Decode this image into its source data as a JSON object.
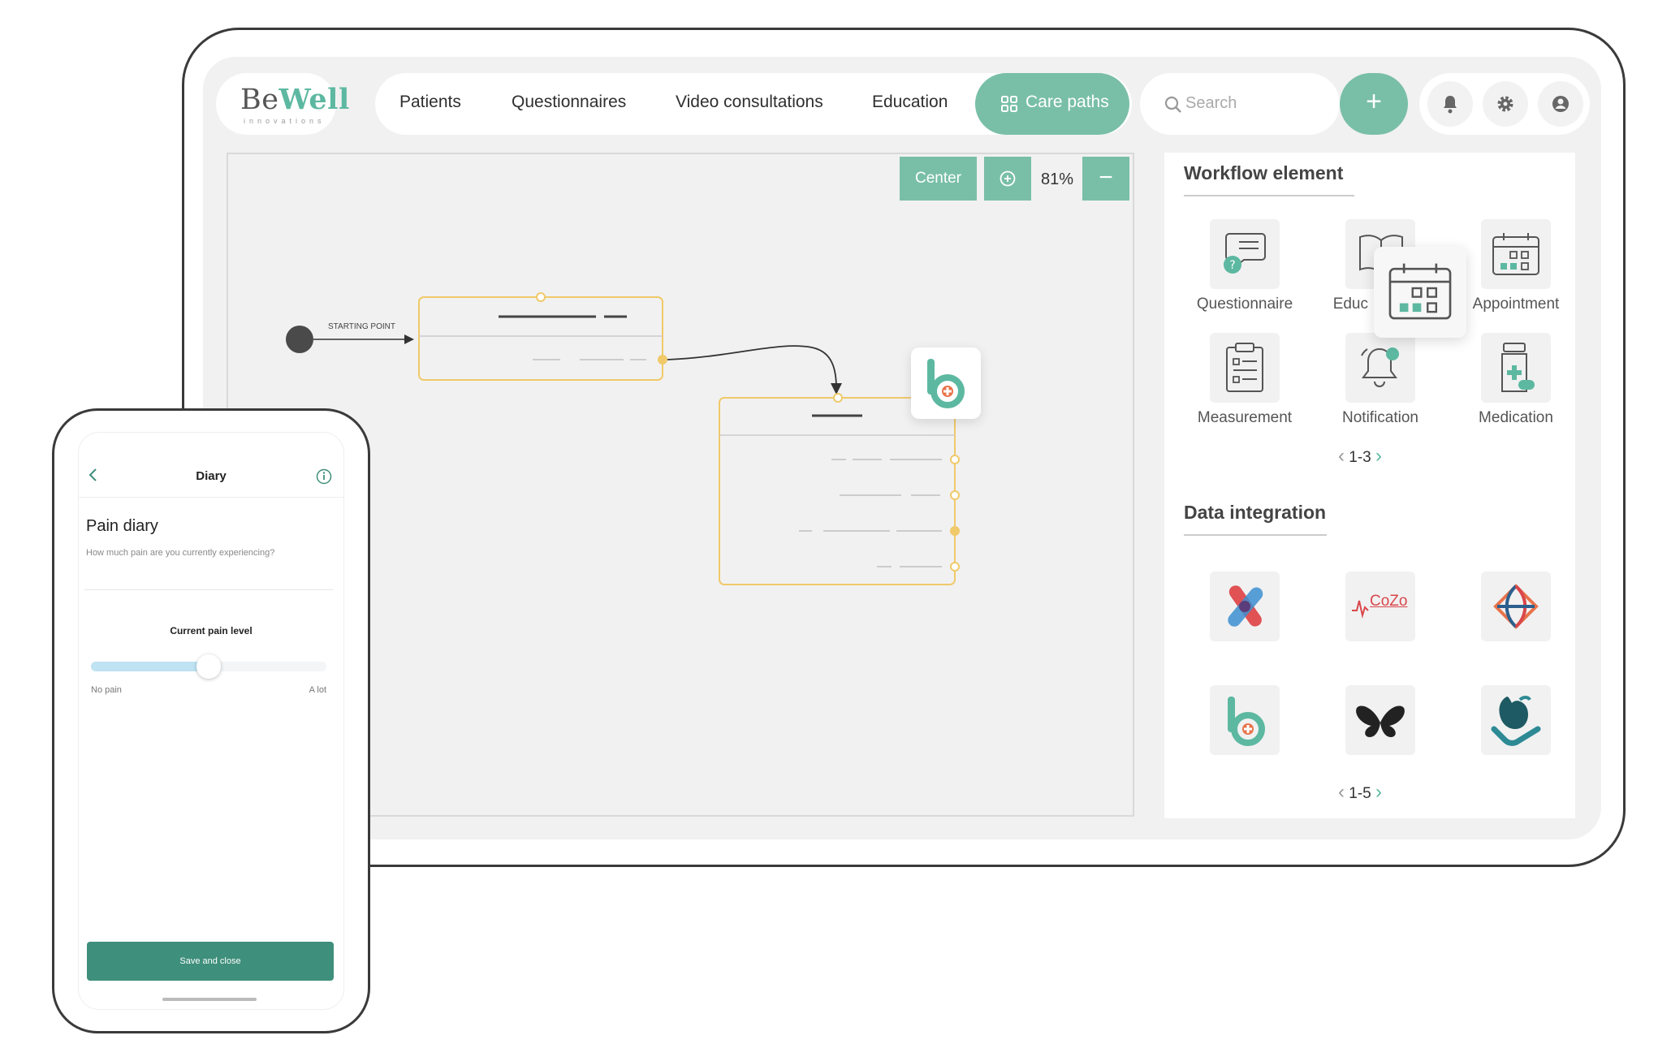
{
  "brand": {
    "name_a": "Be",
    "name_b": "Well",
    "tagline": "innovations"
  },
  "nav": {
    "items": [
      "Patients",
      "Questionnaires",
      "Video consultations",
      "Education"
    ],
    "active": "Care paths",
    "search_placeholder": "Search"
  },
  "canvas": {
    "center_label": "Center",
    "zoom": "81%",
    "start_label": "STARTING POINT"
  },
  "panel": {
    "workflow_title": "Workflow element",
    "workflow_items": [
      "Questionnaire",
      "Education",
      "Appointment",
      "Measurement",
      "Notification",
      "Medication"
    ],
    "workflow_items_visible": [
      "Questionnaire",
      "Educ",
      "Appointment",
      "Measurement",
      "Notification",
      "Medication"
    ],
    "workflow_pager": "1-3",
    "data_title": "Data integration",
    "integrations": [
      "plaster-logo",
      "CoZo",
      "globe-logo",
      "bewell-b-logo",
      "butterfly-logo",
      "heart-hand-logo"
    ],
    "cozo_text": "CoZo",
    "data_pager": "1-5"
  },
  "phone": {
    "header_title": "Diary",
    "title": "Pain diary",
    "question": "How much pain are you currently experiencing?",
    "slider_label": "Current pain level",
    "slider_value": 0.45,
    "min_label": "No pain",
    "max_label": "A lot",
    "save_label": "Save and close"
  },
  "colors": {
    "accent": "#79bfa7",
    "accent_dark": "#3e8f7b",
    "node_border": "#f0c96a",
    "slider": "#bfe3f2"
  }
}
